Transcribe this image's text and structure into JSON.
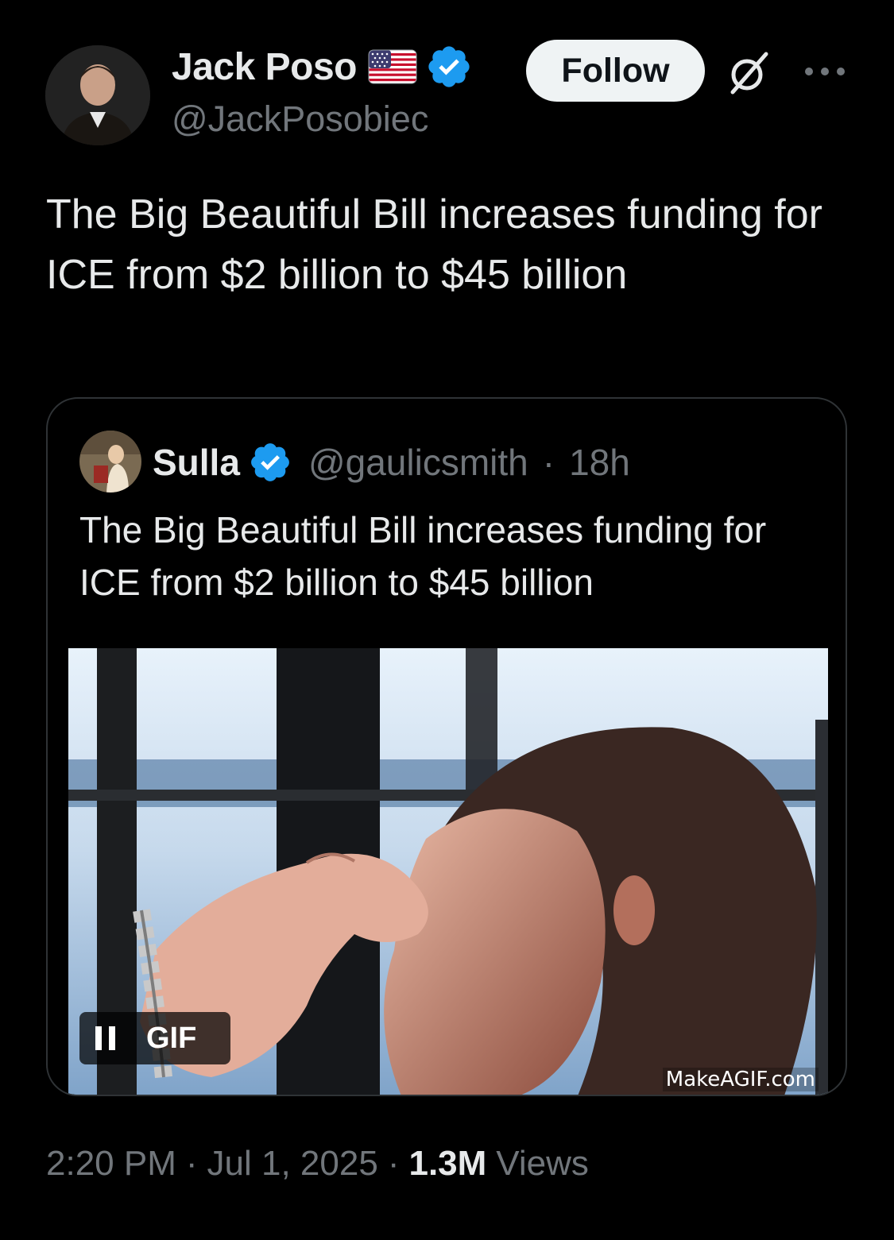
{
  "author": {
    "display_name": "Jack Poso",
    "handle": "@JackPosobiec",
    "flag_icon": "us-flag-icon",
    "verified_icon": "verified-badge-icon",
    "verified_color": "#1d9bf0"
  },
  "actions": {
    "follow_label": "Follow",
    "grok_icon": "grok-icon",
    "more_icon": "more-icon"
  },
  "tweet": {
    "text": "The Big Beautiful Bill increases funding for ICE from $2 billion to $45 billion"
  },
  "quote": {
    "display_name": "Sulla",
    "handle": "@gaulicsmith",
    "separator": "·",
    "time": "18h",
    "text": "The Big Beautiful Bill increases funding for ICE from $2 billion to $45 billion",
    "media": {
      "badge_label": "GIF",
      "pause_icon": "pause-icon",
      "watermark": "MakeAGIF.com"
    }
  },
  "footer": {
    "time": "2:20 PM",
    "sep1": "·",
    "date": "Jul 1, 2025",
    "sep2": "·",
    "views_count": "1.3M",
    "views_label": "Views"
  },
  "colors": {
    "background": "#000000",
    "text_primary": "#e7e9ea",
    "text_secondary": "#71767b",
    "border": "#2f3336",
    "follow_bg": "#eff3f4"
  }
}
